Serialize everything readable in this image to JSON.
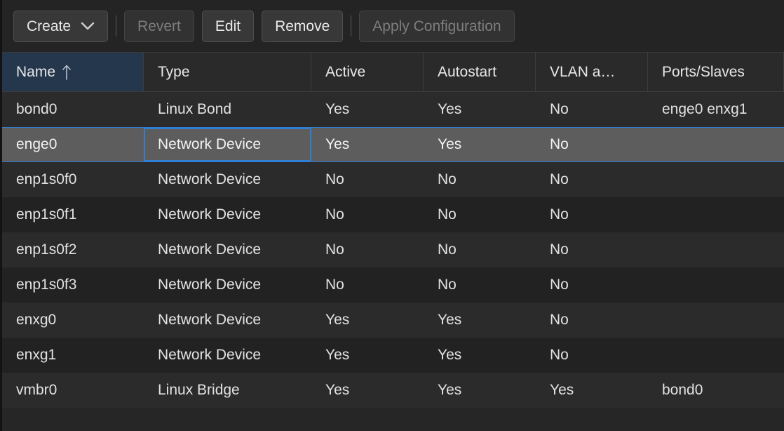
{
  "toolbar": {
    "items": [
      {
        "kind": "button",
        "name": "create-button",
        "label": "Create",
        "icon": "chevron-down-icon",
        "disabled": false
      },
      {
        "kind": "separator",
        "name": "toolbar-separator-1"
      },
      {
        "kind": "button",
        "name": "revert-button",
        "label": "Revert",
        "disabled": true
      },
      {
        "kind": "button",
        "name": "edit-button",
        "label": "Edit",
        "disabled": false
      },
      {
        "kind": "button",
        "name": "remove-button",
        "label": "Remove",
        "disabled": false
      },
      {
        "kind": "separator",
        "name": "toolbar-separator-2"
      },
      {
        "kind": "button",
        "name": "apply-configuration-button",
        "label": "Apply Configuration",
        "disabled": true
      }
    ]
  },
  "table": {
    "columns": [
      {
        "key": "name",
        "label": "Name",
        "sorted": true,
        "sort_direction": "asc",
        "sort_icon": "arrow-up-icon"
      },
      {
        "key": "type",
        "label": "Type",
        "sorted": false
      },
      {
        "key": "active",
        "label": "Active",
        "sorted": false
      },
      {
        "key": "auto",
        "label": "Autostart",
        "sorted": false
      },
      {
        "key": "vlan",
        "label": "VLAN a…",
        "sorted": false
      },
      {
        "key": "ports",
        "label": "Ports/Slaves",
        "sorted": false
      }
    ],
    "rows": [
      {
        "name": "bond0",
        "type": "Linux Bond",
        "active": "Yes",
        "auto": "Yes",
        "vlan": "No",
        "ports": "enge0 enxg1",
        "selected": false
      },
      {
        "name": "enge0",
        "type": "Network Device",
        "active": "Yes",
        "auto": "Yes",
        "vlan": "No",
        "ports": "",
        "selected": true,
        "focused_column": "type"
      },
      {
        "name": "enp1s0f0",
        "type": "Network Device",
        "active": "No",
        "auto": "No",
        "vlan": "No",
        "ports": "",
        "selected": false
      },
      {
        "name": "enp1s0f1",
        "type": "Network Device",
        "active": "No",
        "auto": "No",
        "vlan": "No",
        "ports": "",
        "selected": false
      },
      {
        "name": "enp1s0f2",
        "type": "Network Device",
        "active": "No",
        "auto": "No",
        "vlan": "No",
        "ports": "",
        "selected": false
      },
      {
        "name": "enp1s0f3",
        "type": "Network Device",
        "active": "No",
        "auto": "No",
        "vlan": "No",
        "ports": "",
        "selected": false
      },
      {
        "name": "enxg0",
        "type": "Network Device",
        "active": "Yes",
        "auto": "Yes",
        "vlan": "No",
        "ports": "",
        "selected": false
      },
      {
        "name": "enxg1",
        "type": "Network Device",
        "active": "Yes",
        "auto": "Yes",
        "vlan": "No",
        "ports": "",
        "selected": false
      },
      {
        "name": "vmbr0",
        "type": "Linux Bridge",
        "active": "Yes",
        "auto": "Yes",
        "vlan": "Yes",
        "ports": "bond0",
        "selected": false
      }
    ]
  },
  "colors": {
    "background": "#242424",
    "grid_background": "#262626",
    "row_odd": "#2b2b2b",
    "row_even": "#222222",
    "row_selected": "#5d5d5d",
    "header_sorted": "#24374d",
    "focus_outline": "#2f7fd4",
    "text": "#e2e2e2",
    "text_disabled": "#7d7d7d"
  }
}
